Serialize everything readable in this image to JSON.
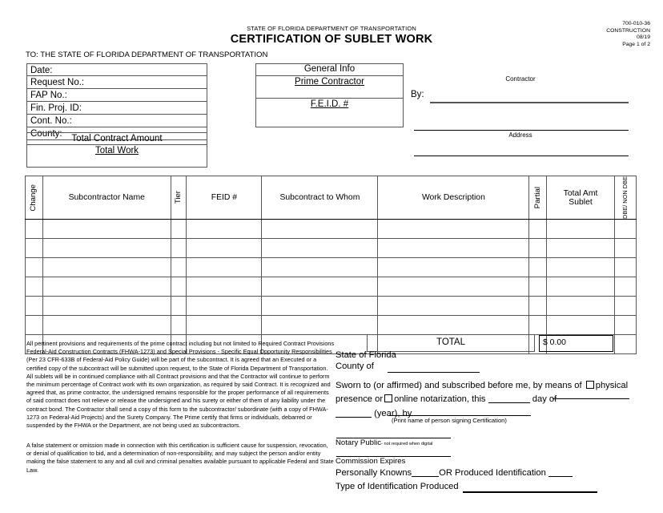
{
  "header": {
    "agency": "STATE OF FLORIDA DEPARTMENT OF TRANSPORTATION",
    "title": "CERTIFICATION OF SUBLET WORK",
    "form_number": "700-010-36",
    "division": "CONSTRUCTION",
    "revision": "08/19",
    "page": "Page 1 of 2",
    "to_line": "TO:  THE STATE OF FLORIDA DEPARTMENT OF TRANSPORTATION"
  },
  "left_fields": [
    {
      "label": "Date:",
      "value": ""
    },
    {
      "label": "Request No.:",
      "value": ""
    },
    {
      "label": "FAP No.:",
      "value": ""
    },
    {
      "label": "Fin. Proj. ID:",
      "value": ""
    },
    {
      "label": "Cont. No.:",
      "value": ""
    },
    {
      "label": "County:",
      "value": ""
    }
  ],
  "contract_amount": {
    "header": "Total Contract Amount",
    "total_work_label": "Total Work",
    "total_work_value": ""
  },
  "general_info": {
    "title": "General Info",
    "prime_contractor_label": "Prime Contractor",
    "prime_contractor_value": "",
    "feid_label": "F.E.I.D. #",
    "feid_value": ""
  },
  "signature_block": {
    "contractor_label": "Contractor",
    "by_label": "By:",
    "by_value": "",
    "address_label": "Address",
    "address_value": "",
    "address_value2": ""
  },
  "table": {
    "columns": [
      {
        "label": "Change",
        "orientation": "vertical"
      },
      {
        "label": "Subcontractor Name",
        "orientation": "horizontal"
      },
      {
        "label": "Tier",
        "orientation": "vertical"
      },
      {
        "label": "FEID #",
        "orientation": "horizontal"
      },
      {
        "label": "Subcontract to Whom",
        "orientation": "horizontal"
      },
      {
        "label": "Work Description",
        "orientation": "horizontal"
      },
      {
        "label": "Partial",
        "orientation": "vertical"
      },
      {
        "label": "Total Amt Sublet",
        "orientation": "horizontal"
      },
      {
        "label": "DBE/ NON DBE",
        "orientation": "vertical"
      }
    ],
    "total_amt_line1": "Total Amt",
    "total_amt_line2": "Sublet",
    "dbe_line1": "DBE/",
    "dbe_line2": "NON DBE",
    "row_count": 7,
    "rows": [
      [
        "",
        "",
        "",
        "",
        "",
        "",
        "",
        "",
        ""
      ],
      [
        "",
        "",
        "",
        "",
        "",
        "",
        "",
        "",
        ""
      ],
      [
        "",
        "",
        "",
        "",
        "",
        "",
        "",
        "",
        ""
      ],
      [
        "",
        "",
        "",
        "",
        "",
        "",
        "",
        "",
        ""
      ],
      [
        "",
        "",
        "",
        "",
        "",
        "",
        "",
        "",
        ""
      ],
      [
        "",
        "",
        "",
        "",
        "",
        "",
        "",
        "",
        ""
      ],
      [
        "",
        "",
        "",
        "",
        "",
        "",
        "",
        "",
        ""
      ]
    ],
    "total_label": "TOTAL",
    "total_value": "$ 0.00"
  },
  "legal": {
    "paragraph1": "All pertinent provisions and requirements of the prime contract including but not limited to Required Contract Provisions Federal-Aid Construction Contracts (FHWA-1273) and Special Provisions - Specific Equal Opportunity Responsibilities (Per 23 CFR-633B of Federal-Aid Policy Guide) will be part of the subcontract.  It is agreed that an Executed or a certified copy of the subcontract will be submitted upon request, to the State of Florida Department of Transportation.  All sublets will be in continued compliance with all Contract provisions and that the Contractor will continue to perform the minimum percentage of Contract work with its own organization, as required by said Contract.  It is recognized and agreed that, as prime contractor, the undersigned remains responsible for the proper performance of all requirements of said contract does not relieve or release the undersigned and his surety or either of them of any liability under the contract bond.  The Contractor shall send a copy of this form to the subcontractor/ subordinate (with a copy of FHWA-1273 on Federal-Aid Projects) and the Surety Company.  The Prime certify that firms or individuals, debarred or suspended by the FHWA or the Department, are not being used as subcontractors.",
    "paragraph2": "A false statement or omission made in connection with this certification is sufficient cause for suspension, revocation, or denial of qualification to bid, and a determination of non-responsibility, and may subject the person and/or entity making the false statement to any and all civil and criminal penalties available pursuant to applicable Federal and State Law."
  },
  "notary": {
    "state_label": "State of Florida",
    "county_label": "County of",
    "county_value": "",
    "sworn_line1_a": "Sworn to (or affirmed) and subscribed before me, by means of",
    "sworn_line1_b": "physical",
    "sworn_line2_a": "presence or",
    "sworn_line2_b": "online notarization, this",
    "sworn_line2_c": "day of",
    "sworn_line3": "(year), by",
    "print_name_hint": "(Print name of person signing Certification)",
    "day_value": "",
    "month_value": "",
    "year_value": "",
    "signer_name_value": "",
    "notary_public_label": "Notary Public",
    "notary_public_note": "- not required when digital",
    "notary_signature_value": "",
    "commission_expires_label": "Commission Expires",
    "commission_expires_value": "",
    "personally_known_label": "Personally Knowns",
    "or_produced_label": "OR Produced Identification",
    "type_id_label": "Type of Identification Produced",
    "type_id_value": ""
  },
  "colors": {
    "ink": "#000000",
    "rule": "#555555",
    "paper": "#ffffff"
  }
}
